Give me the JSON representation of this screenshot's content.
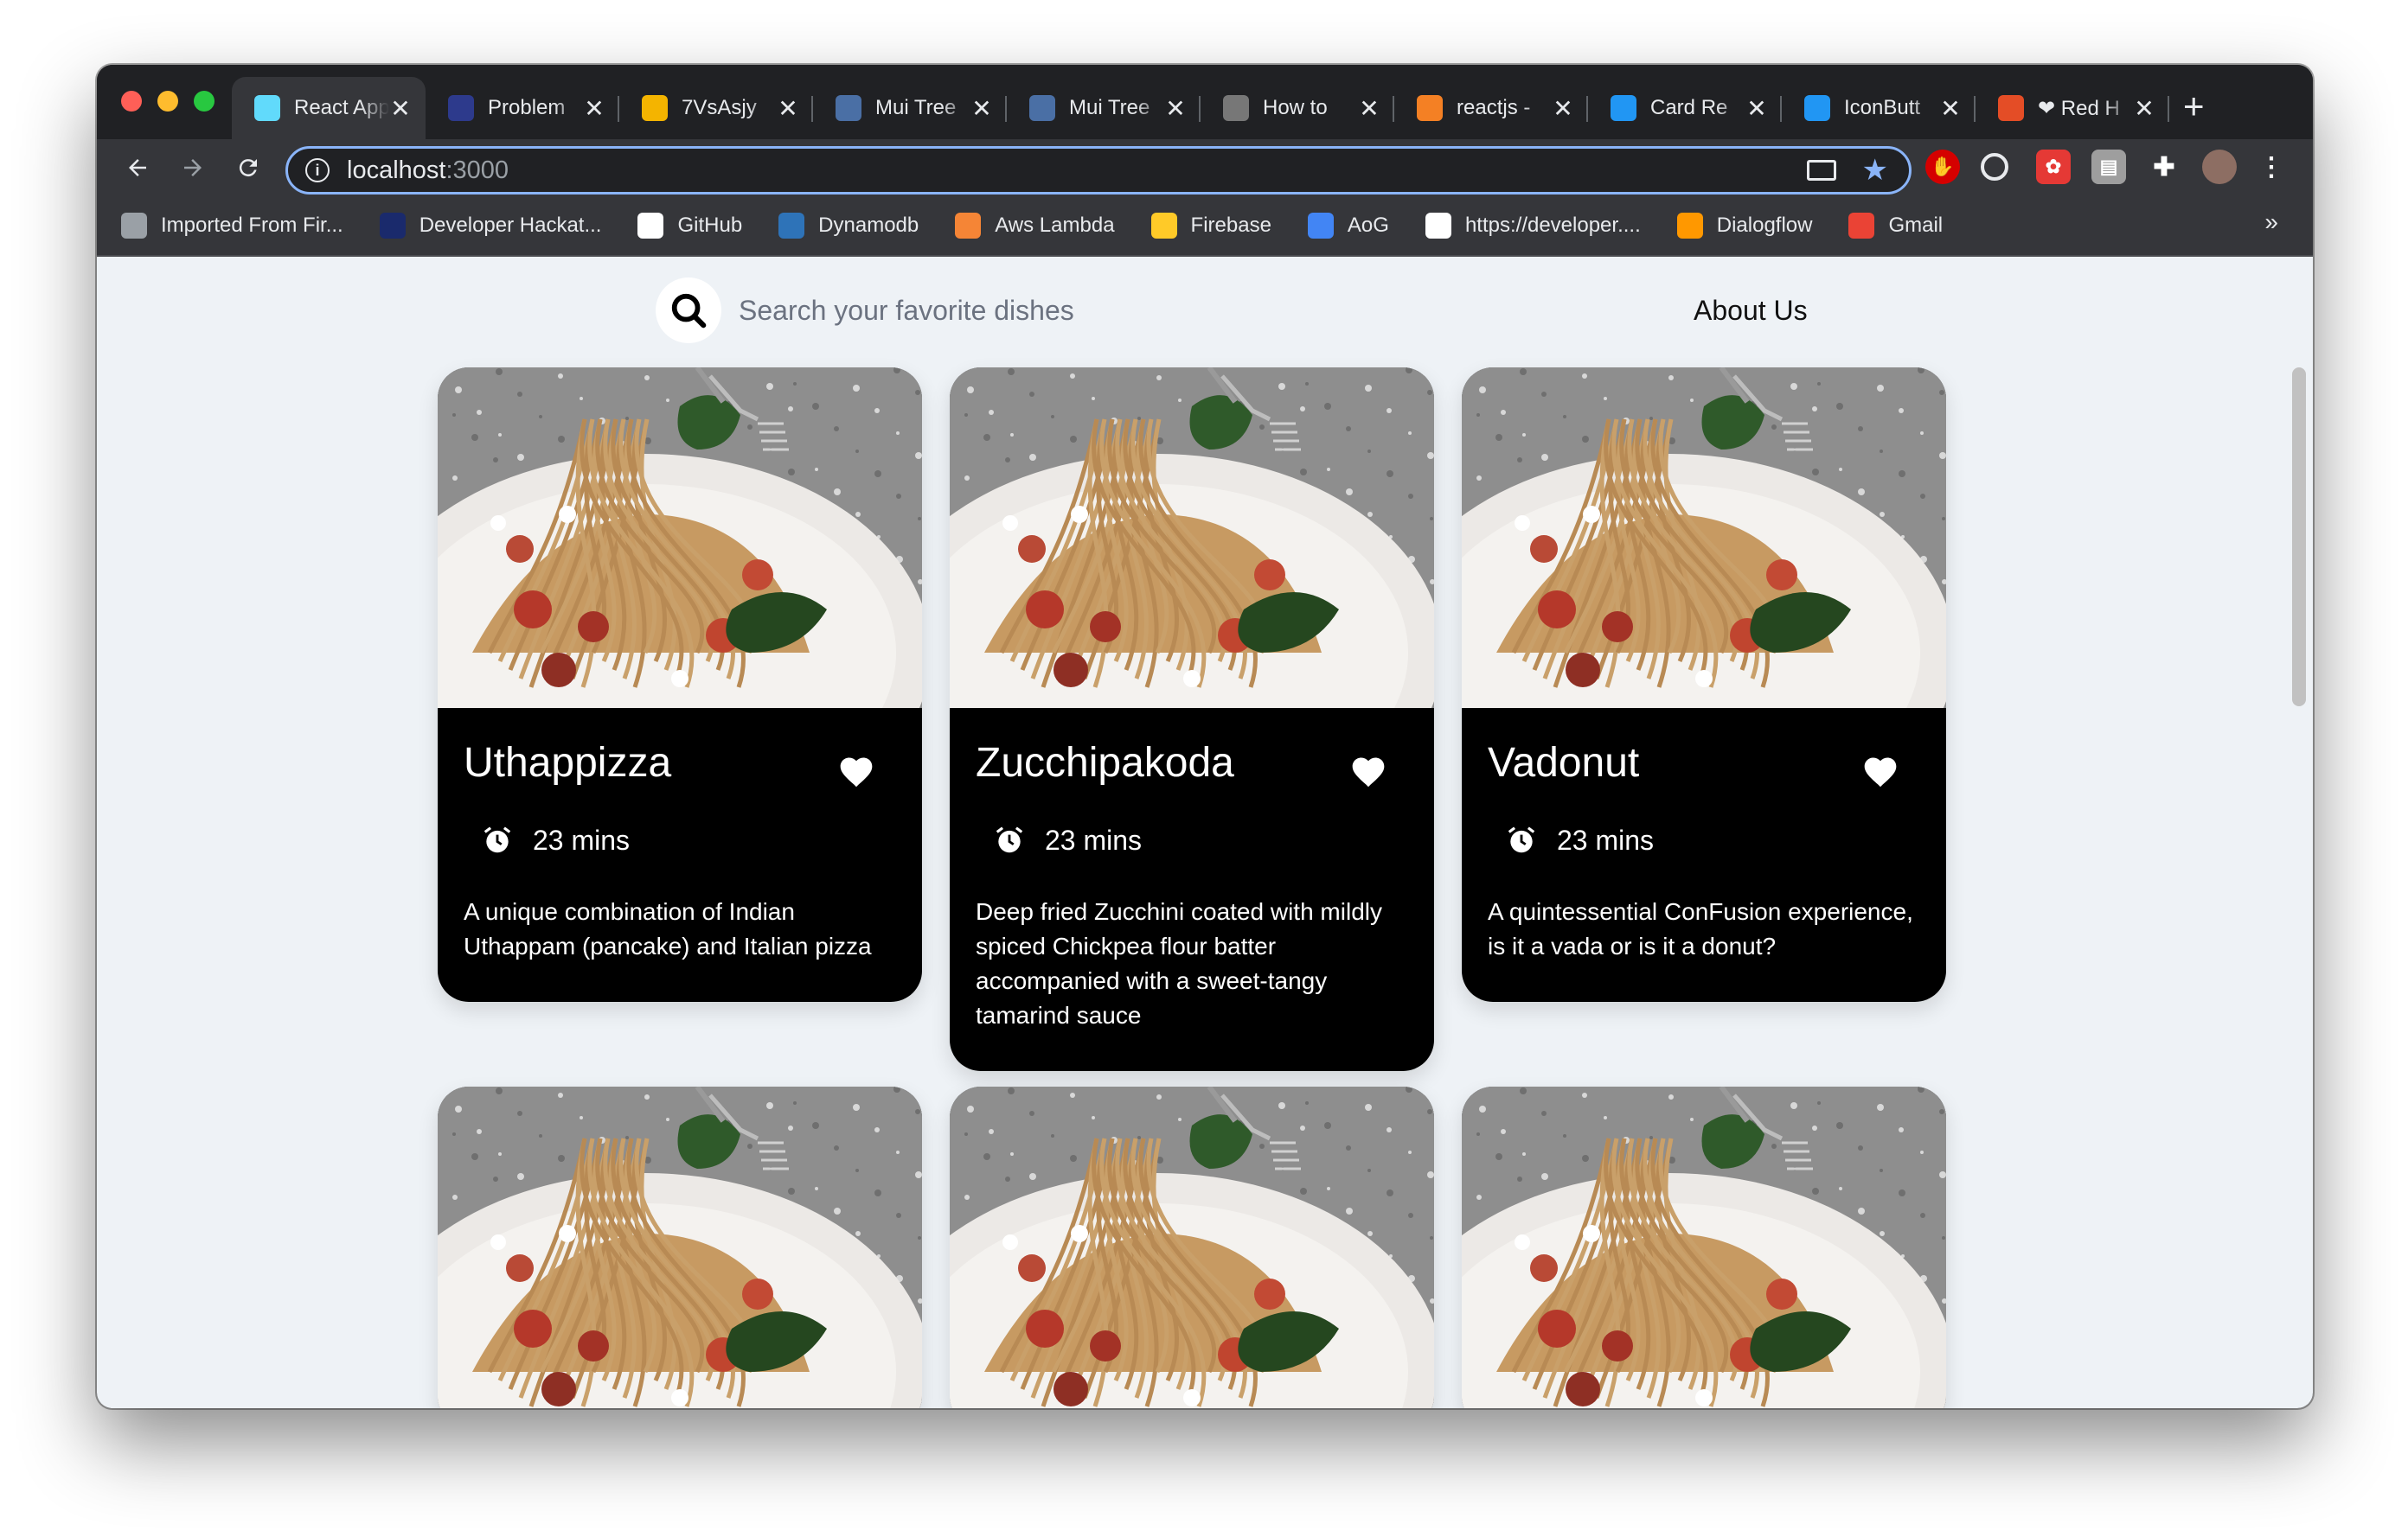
{
  "browser": {
    "tabs": [
      {
        "title": "React App",
        "icon": "react-icon",
        "color": "#61dafb",
        "active": true
      },
      {
        "title": "Problem",
        "icon": "problem-icon",
        "color": "#2d3a8c",
        "active": false
      },
      {
        "title": "7VsAsjy",
        "icon": "pinwheel-icon",
        "color": "#f4b400",
        "active": false
      },
      {
        "title": "Mui Tree",
        "icon": "mui-tree-icon",
        "color": "#4a6fa5",
        "active": false
      },
      {
        "title": "Mui Tree",
        "icon": "mui-tree-icon",
        "color": "#4a6fa5",
        "active": false
      },
      {
        "title": "How to",
        "icon": "video-icon",
        "color": "#777777",
        "active": false
      },
      {
        "title": "reactjs -",
        "icon": "stackoverflow-icon",
        "color": "#f48024",
        "active": false
      },
      {
        "title": "Card Re",
        "icon": "mui-icon",
        "color": "#2196f3",
        "active": false
      },
      {
        "title": "IconButt",
        "icon": "mui-icon",
        "color": "#2196f3",
        "active": false
      },
      {
        "title": "❤ Red H",
        "icon": "html5-icon",
        "color": "#e44d26",
        "active": false
      }
    ],
    "new_tab": "+",
    "url_host": "localhost",
    "url_port": ":3000",
    "bookmarks": [
      {
        "label": "Imported From Fir...",
        "icon": "folder-icon",
        "color": "#9aa0a6"
      },
      {
        "label": "Developer Hackat...",
        "icon": "hackathon-icon",
        "color": "#1a2a6c"
      },
      {
        "label": "GitHub",
        "icon": "github-icon",
        "color": "#ffffff"
      },
      {
        "label": "Dynamodb",
        "icon": "dynamodb-icon",
        "color": "#2e73b8"
      },
      {
        "label": "Aws Lambda",
        "icon": "lambda-icon",
        "color": "#f58536"
      },
      {
        "label": "Firebase",
        "icon": "firebase-icon",
        "color": "#ffca28"
      },
      {
        "label": "AoG",
        "icon": "google-assistant-icon",
        "color": "#4285f4"
      },
      {
        "label": "https://developer....",
        "icon": "amazon-icon",
        "color": "#ffffff"
      },
      {
        "label": "Dialogflow",
        "icon": "dialogflow-icon",
        "color": "#ff9800"
      },
      {
        "label": "Gmail",
        "icon": "gmail-icon",
        "color": "#ea4335"
      }
    ],
    "bookmarks_more": "»"
  },
  "app": {
    "search_placeholder": "Search your favorite dishes",
    "about_label": "About Us",
    "dishes": [
      {
        "name": "Uthappizza",
        "time": "23 mins",
        "description": "A unique combination of Indian Uthappam (pancake) and Italian pizza"
      },
      {
        "name": "Zucchipakoda",
        "time": "23 mins",
        "description": "Deep fried Zucchini coated with mildly spiced Chickpea flour batter accompanied with a sweet-tangy tamarind sauce"
      },
      {
        "name": "Vadonut",
        "time": "23 mins",
        "description": "A quintessential ConFusion experience, is it a vada or is it a donut?"
      },
      {
        "name": "",
        "time": "",
        "description": ""
      },
      {
        "name": "",
        "time": "",
        "description": ""
      },
      {
        "name": "",
        "time": "",
        "description": ""
      }
    ]
  }
}
